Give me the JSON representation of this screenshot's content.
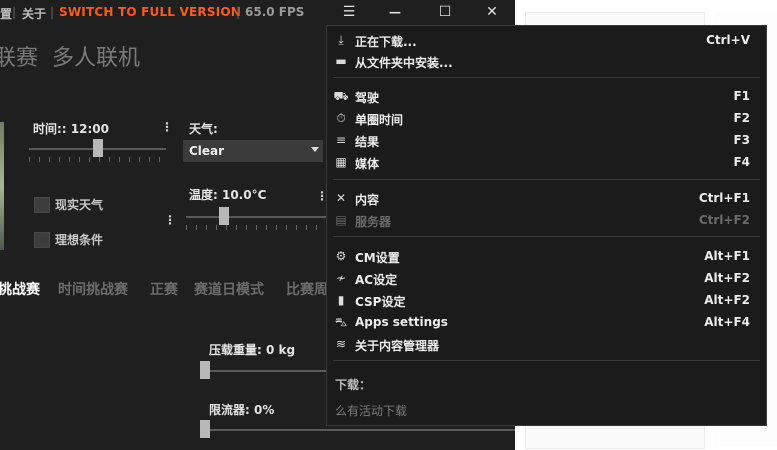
{
  "titlebar": {
    "left_cut": "置",
    "about": "关于",
    "switch": "SWITCH TO FULL VERSION",
    "fps": "65.0 FPS",
    "hamburger": "☰",
    "minimize": "—",
    "maximize": "☐",
    "close": "✕"
  },
  "main": {
    "heading_left": "联赛",
    "heading_right": "多人联机",
    "time_label": "时间:: 12:00",
    "weather_label": "天气:",
    "weather_value": "Clear",
    "real_weather": "现实天气",
    "ideal_conditions": "理想条件",
    "temp_label": "温度: 10.0°C",
    "ballast_label": "压载重量: 0 kg",
    "restrictor_label": "限流器: 0%",
    "menu_dots": "⋮"
  },
  "tabs": [
    {
      "label": "挑战赛",
      "active": true
    },
    {
      "label": "时间挑战赛",
      "active": false
    },
    {
      "label": "正赛",
      "active": false
    },
    {
      "label": "赛道日模式",
      "active": false
    },
    {
      "label": "比赛周",
      "active": false
    }
  ],
  "menu": {
    "items": [
      {
        "icon": "download-icon",
        "glyph": "⤓",
        "label": "正在下载...",
        "key": "Ctrl+V",
        "disabled": false
      },
      {
        "icon": "folder-icon",
        "glyph": "▬",
        "label": "从文件夹中安装...",
        "key": "",
        "disabled": false
      },
      {
        "icon": "car-icon",
        "glyph": "⛟",
        "label": "驾驶",
        "key": "F1",
        "disabled": false
      },
      {
        "icon": "stopwatch-icon",
        "glyph": "⏱",
        "label": "单圈时间",
        "key": "F2",
        "disabled": false
      },
      {
        "icon": "list-icon",
        "glyph": "≡",
        "label": "结果",
        "key": "F3",
        "disabled": false
      },
      {
        "icon": "media-icon",
        "glyph": "▦",
        "label": "媒体",
        "key": "F4",
        "disabled": false
      },
      {
        "icon": "tools-icon",
        "glyph": "✕",
        "label": "内容",
        "key": "Ctrl+F1",
        "disabled": false
      },
      {
        "icon": "server-icon",
        "glyph": "▤",
        "label": "服务器",
        "key": "Ctrl+F2",
        "disabled": true
      },
      {
        "icon": "gear-icon",
        "glyph": "⚙",
        "label": "CM设置",
        "key": "Alt+F1",
        "disabled": false
      },
      {
        "icon": "ac-settings-icon",
        "glyph": "≁",
        "label": "AC设定",
        "key": "Alt+F2",
        "disabled": false
      },
      {
        "icon": "bookmark-icon",
        "glyph": "▮",
        "label": "CSP设定",
        "key": "Alt+F2",
        "disabled": false
      },
      {
        "icon": "apps-car-icon",
        "glyph": "⛍",
        "label": "Apps settings",
        "key": "Alt+F4",
        "disabled": false
      },
      {
        "icon": "about-icon",
        "glyph": "≋",
        "label": "关于内容管理器",
        "key": "",
        "disabled": false
      }
    ],
    "downloads_title": "下载：",
    "downloads_empty": "么有活动下载"
  }
}
